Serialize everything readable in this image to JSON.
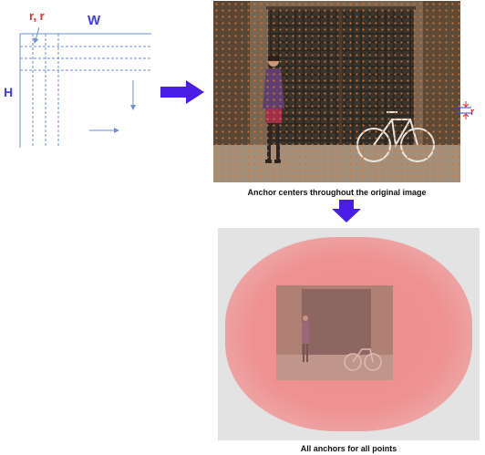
{
  "grid_diagram": {
    "w_label": "W",
    "h_label": "H",
    "r_label": "r, r"
  },
  "photo_panel": {
    "r_marker_label": "r",
    "caption": "Anchor centers throughout the original image"
  },
  "anchors_panel": {
    "caption": "All anchors for all points"
  },
  "colors": {
    "arrow": "#4b1ee8",
    "grid_line": "#6f8fd8",
    "label_blue": "#3d3df0",
    "label_red": "#e8262b",
    "anchor_glow": "#ef8f8f"
  }
}
